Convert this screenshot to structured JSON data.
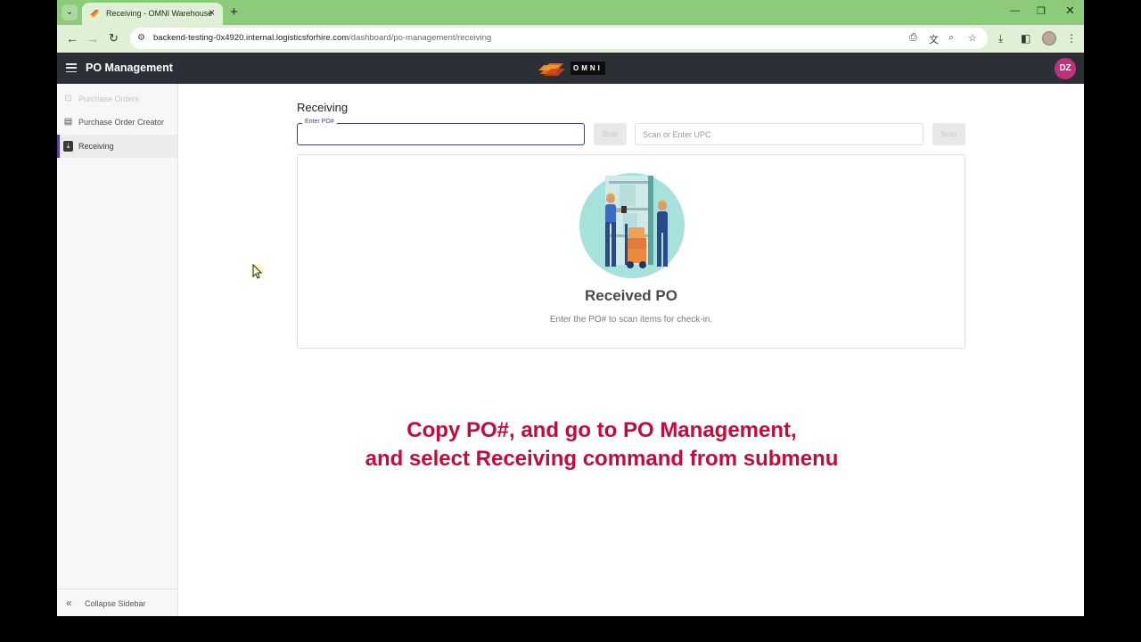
{
  "browser": {
    "tab_title": "Receiving - OMNI Warehouse",
    "url_host": "backend-testing-0x4920.internal.logisticsforhire.com",
    "url_path": "/dashboard/po-management/receiving"
  },
  "app": {
    "title": "PO Management",
    "logo_text": "OMNI",
    "avatar_initials": "DZ",
    "avatar_color": "#c2307f"
  },
  "sidebar": {
    "items": [
      {
        "label": "Purchase Orders",
        "icon": "cart-icon",
        "state": "disabled"
      },
      {
        "label": "Purchase Order Creator",
        "icon": "document-icon",
        "state": "normal"
      },
      {
        "label": "Receiving",
        "icon": "receive-icon",
        "state": "active"
      }
    ],
    "collapse_label": "Collapse Sidebar"
  },
  "main": {
    "title": "Receiving",
    "po_field_label": "Enter PO#",
    "po_value": "",
    "scan_po_label": "Scan",
    "upc_placeholder": "Scan or Enter UPC",
    "scan_upc_label": "Scan",
    "empty_title": "Received PO",
    "empty_subtitle": "Enter the PO# to scan items for check-in."
  },
  "overlay": {
    "line1": "Copy PO#, and go to PO Management,",
    "line2": "and select Receiving command from submenu"
  }
}
